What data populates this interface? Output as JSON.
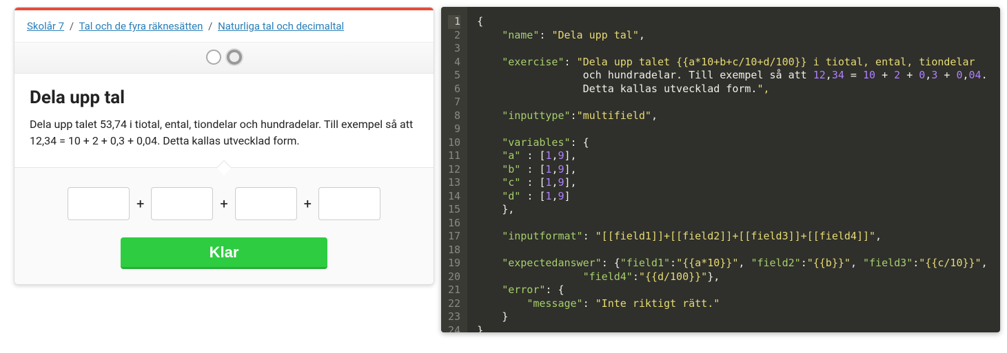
{
  "breadcrumb": {
    "item1": "Skolår 7",
    "item2": "Tal och de fyra räknesätten",
    "item3": "Naturliga tal och decimaltal"
  },
  "exercise": {
    "title": "Dela upp tal",
    "description": "Dela upp talet 53,74 i tiotal, ental, tiondelar och hundradelar. Till exempel så att 12,34 = 10 + 2 + 0,3 + 0,04. Detta kallas utvecklad form.",
    "plus": "+",
    "done_label": "Klar"
  },
  "code": {
    "lines": [
      "{",
      "    \"name\": \"Dela upp tal\",",
      "",
      "    \"exercise\": \"Dela upp talet {{a*10+b+c/10+d/100}} i tiotal, ental, tiondelar",
      "                 och hundradelar. Till exempel så att 12,34 = 10 + 2 + 0,3 + 0,04.",
      "                 Detta kallas utvecklad form.\",",
      "",
      "    \"inputtype\":\"multifield\",",
      "",
      "    \"variables\": {",
      "    \"a\" : [1,9],",
      "    \"b\" : [1,9],",
      "    \"c\" : [1,9],",
      "    \"d\" : [1,9]",
      "    },",
      "",
      "    \"inputformat\": \"[[field1]]+[[field2]]+[[field3]]+[[field4]]\",",
      "",
      "    \"expectedanswer\": {\"field1\":\"{{a*10}}\", \"field2\":\"{{b}}\", \"field3\":\"{{c/10}}\",",
      "                 \"field4\":\"{{d/100}}\"},",
      "    \"error\": {",
      "        \"message\": \"Inte riktigt rätt.\"",
      "    }",
      "}"
    ]
  }
}
